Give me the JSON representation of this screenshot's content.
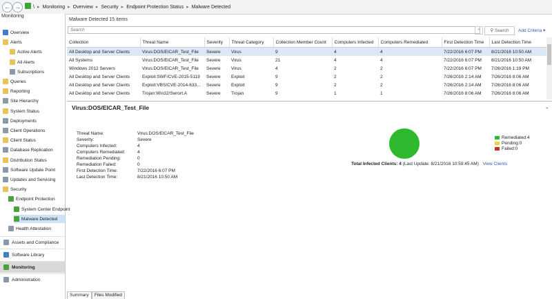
{
  "nav": {
    "breadcrumbs": [
      "\\",
      "Monitoring",
      "Overview",
      "Security",
      "Endpoint Protection Status",
      "Malware Detected"
    ]
  },
  "sidebar": {
    "title": "Monitoring",
    "items": [
      {
        "label": "Overview",
        "icon": "overview-icon"
      },
      {
        "label": "Alerts",
        "icon": "folder-icon"
      },
      {
        "label": "Active Alerts",
        "icon": "folder-icon"
      },
      {
        "label": "All Alerts",
        "icon": "folder-icon"
      },
      {
        "label": "Subscriptions",
        "icon": "subscription-icon"
      },
      {
        "label": "Queries",
        "icon": "folder-icon"
      },
      {
        "label": "Reporting",
        "icon": "folder-icon"
      },
      {
        "label": "Site Hierarchy",
        "icon": "hierarchy-icon"
      },
      {
        "label": "System Status",
        "icon": "folder-icon"
      },
      {
        "label": "Deployments",
        "icon": "deployments-icon"
      },
      {
        "label": "Client Operations",
        "icon": "client-operations-icon"
      },
      {
        "label": "Client Status",
        "icon": "folder-icon"
      },
      {
        "label": "Database Replication",
        "icon": "database-icon"
      },
      {
        "label": "Distribution Status",
        "icon": "folder-icon"
      },
      {
        "label": "Software Update Point",
        "icon": "update-icon"
      },
      {
        "label": "Updates and Servicing",
        "icon": "update-icon"
      },
      {
        "label": "Security",
        "icon": "folder-icon"
      },
      {
        "label": "Endpoint Protection",
        "icon": "shield-icon"
      },
      {
        "label": "System Center Endpoint",
        "icon": "shield-icon"
      },
      {
        "label": "Malware Detected",
        "icon": "shield-icon"
      },
      {
        "label": "Health Attestation",
        "icon": "health-icon"
      }
    ],
    "workspaces": [
      {
        "label": "Assets and Compliance",
        "icon": "assets-icon"
      },
      {
        "label": "Software Library",
        "icon": "library-icon"
      },
      {
        "label": "Monitoring",
        "icon": "monitoring-icon"
      },
      {
        "label": "Administration",
        "icon": "admin-icon"
      }
    ]
  },
  "main": {
    "title": "Malware Detected 15 items",
    "search_placeholder": "Search",
    "search_button": "Search",
    "add_criteria": "Add Criteria",
    "columns": [
      "Collection",
      "Threat Name",
      "Severity",
      "Threat Category",
      "Collection Member Count",
      "Computers Infected",
      "Computers Remediated",
      "First Detection Time",
      "Last Detection Time"
    ],
    "rows": [
      [
        "All Desktop and Server Clients",
        "Virus:DOS/EICAR_Test_File",
        "Severe",
        "Virus",
        "9",
        "4",
        "4",
        "7/22/2016 6:07 PM",
        "8/21/2016 10:50 AM"
      ],
      [
        "All Systems",
        "Virus:DOS/EICAR_Test_File",
        "Severe",
        "Virus",
        "21",
        "4",
        "4",
        "7/22/2016 6:07 PM",
        "8/21/2016 10:50 AM"
      ],
      [
        "Windows 2012 Servers",
        "Virus:DOS/EICAR_Test_File",
        "Severe",
        "Virus",
        "4",
        "2",
        "2",
        "7/22/2016 6:07 PM",
        "7/26/2016 1:19 PM"
      ],
      [
        "All Desktop and Server Clients",
        "Exploit:SWF/CVE-2015-5119",
        "Severe",
        "Exploit",
        "9",
        "2",
        "2",
        "7/26/2016 2:14 AM",
        "7/26/2016 8:06 AM"
      ],
      [
        "All Desktop and Server Clients",
        "Exploit:VBS/CVE-2014-633...",
        "Severe",
        "Exploit",
        "9",
        "2",
        "2",
        "7/26/2016 2:14 AM",
        "7/26/2016 8:06 AM"
      ],
      [
        "All Desktop and Server Clients",
        "Trojan:Win32/Swrort.A",
        "Severe",
        "Trojan",
        "9",
        "1",
        "1",
        "7/26/2016 8:06 AM",
        "7/26/2016 8:06 AM"
      ]
    ]
  },
  "detail": {
    "title": "Virus:DOS/EICAR_Test_File",
    "properties": [
      {
        "key": "Threat Name:",
        "value": "Virus:DOS/EICAR_Test_File"
      },
      {
        "key": "Severity:",
        "value": "Severe"
      },
      {
        "key": "Computers Infected:",
        "value": "4"
      },
      {
        "key": "Computers Remediated:",
        "value": "4"
      },
      {
        "key": "Remediation Pending:",
        "value": "0"
      },
      {
        "key": "Remediation Failed:",
        "value": "0"
      },
      {
        "key": "First Detection Time:",
        "value": "7/22/2016 6:07 PM"
      },
      {
        "key": "Last Detection Time:",
        "value": "8/21/2016 10:50 AM"
      }
    ],
    "total_label": "Total Infected Clients: 4",
    "last_update": " (Last Update: 8/21/2016 10:59:45 AM)",
    "view_clients": "View Clients",
    "legend": [
      {
        "label": "Remediated:4",
        "color": "#2db82d"
      },
      {
        "label": "Pending:0",
        "color": "#e6d43a"
      },
      {
        "label": "Failed:0",
        "color": "#c0312b"
      }
    ]
  },
  "tabs": [
    "Summary",
    "Files Modified"
  ]
}
